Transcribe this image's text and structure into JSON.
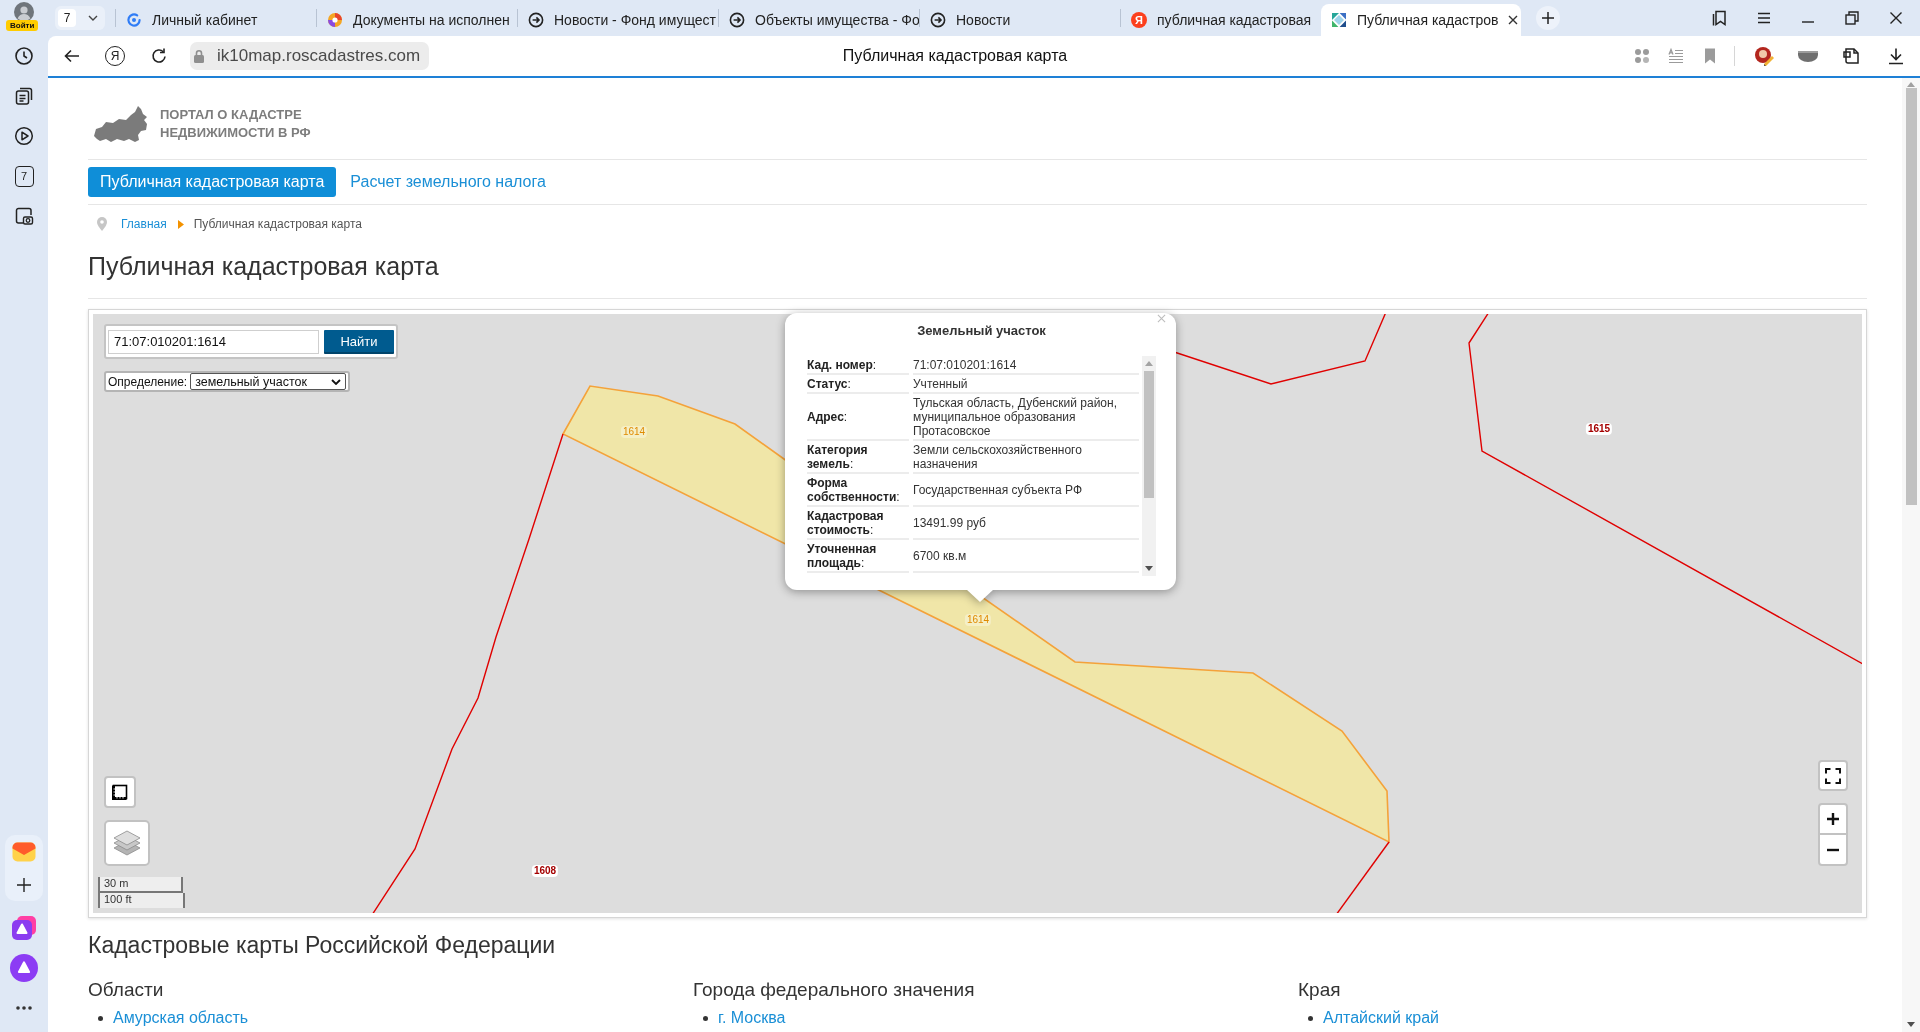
{
  "browser": {
    "profile_label": "Войти",
    "tab_count": "7",
    "tabs": [
      {
        "title": "Личный кабинет",
        "kind": "sync",
        "selected": false
      },
      {
        "title": "Документы на исполнен",
        "kind": "ball",
        "selected": false
      },
      {
        "title": "Новости - Фонд имущест",
        "kind": "arrow",
        "selected": false
      },
      {
        "title": "Объекты имущества - Фо",
        "kind": "arrow",
        "selected": false
      },
      {
        "title": "Новости",
        "kind": "arrow",
        "selected": false
      },
      {
        "title": "публичная кадастровая",
        "kind": "letter",
        "letter": "Я",
        "selected": false
      },
      {
        "title": "Публичная кадастров",
        "kind": "tiles",
        "selected": true
      }
    ],
    "home_button": "Я",
    "url": "ik10map.roscadastres.com",
    "page_title": "Публичная кадастровая карта",
    "sidebar": {
      "calendar_day": "7"
    }
  },
  "site": {
    "logo_text": "ПОРТАЛ О КАДАСТРЕ НЕДВИЖИМОСТИ В РФ",
    "nav": [
      {
        "label": "Публичная кадастровая карта",
        "selected": true
      },
      {
        "label": "Расчет земельного налога",
        "selected": false
      }
    ],
    "breadcrumb": [
      {
        "label": "Главная",
        "kind": "link"
      },
      {
        "label": "Публичная кадастровая карта",
        "kind": "current"
      }
    ],
    "title": "Публичная кадастровая карта",
    "map": {
      "search": {
        "value": "71:07:010201:1614",
        "button": "Найти"
      },
      "definition": {
        "label": "Определение:",
        "value": "земельный участок"
      },
      "parcel_labels": [
        {
          "text": "1614",
          "selected": true
        },
        {
          "text": "1614",
          "selected": true
        },
        {
          "text": "1615",
          "selected": false
        },
        {
          "text": "1608",
          "selected": false
        }
      ],
      "scale": [
        "30 m",
        "100 ft"
      ],
      "popup": {
        "title": "Земельный участок",
        "rows": [
          {
            "label": "**Кад. номер**:",
            "value": "71:07:010201:1614"
          },
          {
            "label": "**Статус**:",
            "value": "Учтенный"
          },
          {
            "label": "**Адрес**:",
            "value": "Тульская область, Дубенский район, муниципальное образования Протасовское"
          },
          {
            "label": "**Категория земель**:",
            "value": "Земли сельскохозяйственного назначения"
          },
          {
            "label": "**Форма собственности**:",
            "value": "Государственная субъекта РФ"
          },
          {
            "label": "**Кадастровая стоимость**:",
            "value": "13491.99 руб"
          },
          {
            "label": "**Уточненная площадь**:",
            "value": "6700 кв.м"
          }
        ]
      }
    },
    "regions": {
      "title": "Кадастровые карты Российской Федерации",
      "groups": [
        {
          "title": "Области",
          "items": [
            "Амурская область"
          ]
        },
        {
          "title": "Города федерального значения",
          "items": [
            "г. Москва"
          ]
        },
        {
          "title": "Края",
          "items": [
            "Алтайский край"
          ]
        }
      ]
    }
  }
}
